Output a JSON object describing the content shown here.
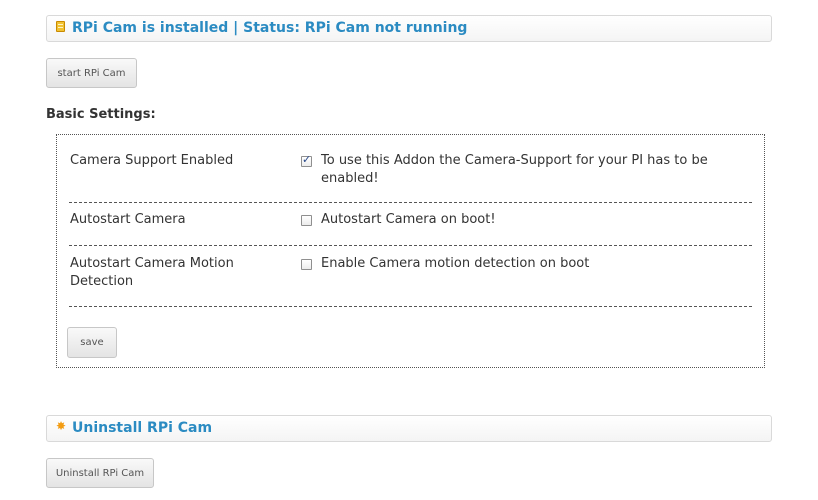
{
  "status_header": {
    "icon": "package-icon",
    "title": "RPi Cam is installed | Status: RPi Cam not running"
  },
  "start_button": {
    "label": "start RPi Cam"
  },
  "basic_settings": {
    "title": "Basic Settings:",
    "rows": [
      {
        "label": "Camera Support Enabled",
        "checked": true,
        "description": "To use this Addon the Camera-Support for your PI has to be enabled!"
      },
      {
        "label": "Autostart Camera",
        "checked": false,
        "description": "Autostart Camera on boot!"
      },
      {
        "label": "Autostart Camera Motion Detection",
        "checked": false,
        "description": "Enable Camera motion detection on boot"
      }
    ],
    "save_label": "save"
  },
  "uninstall_header": {
    "icon": "gear-icon",
    "title": "Uninstall RPi Cam"
  },
  "uninstall_button": {
    "label": "Uninstall RPi Cam"
  },
  "colors": {
    "header_title": "#2b8bc2",
    "package_icon": "#f1c232",
    "gear_icon": "#f39c12"
  }
}
